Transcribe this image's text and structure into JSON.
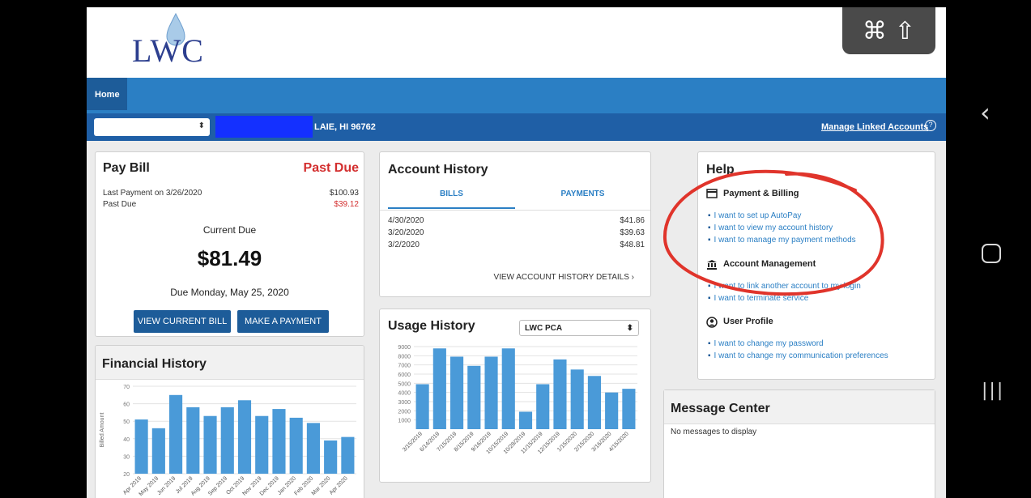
{
  "shortcut_overlay": {
    "cmd": "⌘",
    "shift": "⇧"
  },
  "logo": {
    "text": "LWC"
  },
  "tabs": [
    {
      "label": "Home"
    }
  ],
  "account_bar": {
    "address": "LAIE, HI 96762",
    "manage_link": "Manage Linked Accounts",
    "help_icon": "?"
  },
  "pay_bill": {
    "title": "Pay Bill",
    "status": "Past Due",
    "last_payment_label": "Last Payment on 3/26/2020",
    "last_payment_amount": "$100.93",
    "past_due_label": "Past Due",
    "past_due_amount": "$39.12",
    "current_due_label": "Current Due",
    "current_due_amount": "$81.49",
    "due_date": "Due Monday, May 25, 2020",
    "view_bill_button": "VIEW CURRENT BILL",
    "make_payment_button": "MAKE A PAYMENT"
  },
  "account_history": {
    "title": "Account History",
    "tabs": [
      "BILLS",
      "PAYMENTS"
    ],
    "rows": [
      {
        "date": "4/30/2020",
        "amount": "$41.86"
      },
      {
        "date": "3/20/2020",
        "amount": "$39.63"
      },
      {
        "date": "3/2/2020",
        "amount": "$48.81"
      }
    ],
    "details_link": "VIEW ACCOUNT HISTORY DETAILS ›"
  },
  "usage_history": {
    "title": "Usage History",
    "select_value": "LWC PCA"
  },
  "financial_history": {
    "title": "Financial History"
  },
  "help": {
    "title": "Help",
    "sections": [
      {
        "title": "Payment & Billing",
        "icon": "credit-card-icon",
        "items": [
          "I want to set up AutoPay",
          "I want to view my account history",
          "I want to manage my payment methods"
        ]
      },
      {
        "title": "Account Management",
        "icon": "bank-icon",
        "items": [
          "I want to link another account to my login",
          "I want to terminate service"
        ]
      },
      {
        "title": "User Profile",
        "icon": "user-icon",
        "items": [
          "I want to change my password",
          "I want to change my communication preferences"
        ]
      }
    ]
  },
  "message_center": {
    "title": "Message Center",
    "empty_text": "No messages to display"
  },
  "chart_data": [
    {
      "type": "bar",
      "title": "Financial History",
      "ylabel": "Billed Amount",
      "ylim": [
        20,
        70
      ],
      "yticks": [
        20,
        30,
        40,
        50,
        60,
        70
      ],
      "categories": [
        "Apr 2019",
        "May 2019",
        "Jun 2019",
        "Jul 2019",
        "Aug 2019",
        "Sep 2019",
        "Oct 2019",
        "Nov 2019",
        "Dec 2019",
        "Jan 2020",
        "Feb 2020",
        "Mar 2020",
        "Apr 2020"
      ],
      "values": [
        51,
        46,
        65,
        58,
        53,
        58,
        62,
        53,
        57,
        52,
        49,
        39,
        41
      ],
      "color": "#4a9ad8",
      "grid": true
    },
    {
      "type": "bar",
      "title": "Usage History",
      "ylim": [
        0,
        9000
      ],
      "yticks": [
        1000,
        2000,
        3000,
        4000,
        5000,
        6000,
        7000,
        8000,
        9000
      ],
      "categories": [
        "3/15/2019",
        "6/14/2019",
        "7/15/2019",
        "8/15/2019",
        "9/16/2019",
        "10/15/2019",
        "10/28/2019",
        "11/15/2019",
        "12/15/2019",
        "1/15/2020",
        "2/15/2020",
        "3/16/2020",
        "4/15/2020"
      ],
      "values": [
        4900,
        8800,
        7900,
        6900,
        7900,
        8800,
        1900,
        4900,
        7600,
        6500,
        5800,
        4000,
        4400
      ],
      "color": "#4a9ad8",
      "grid": true
    }
  ]
}
